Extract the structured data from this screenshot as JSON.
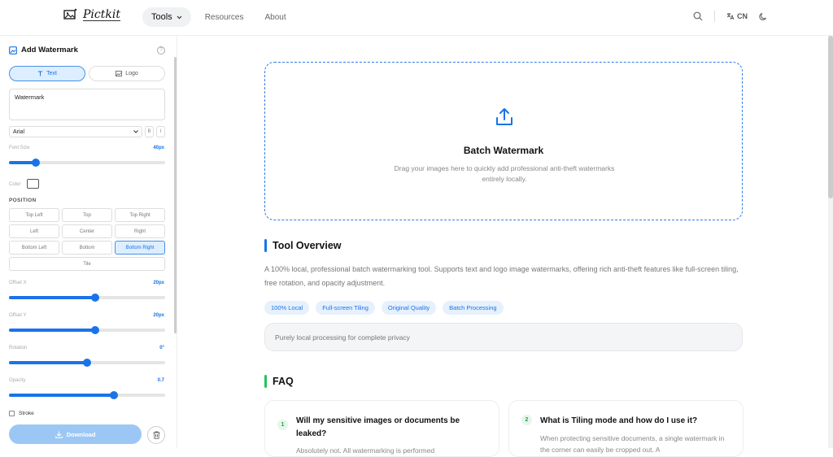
{
  "header": {
    "logo_text": "Pictkit",
    "nav": [
      {
        "label": "Tools"
      },
      {
        "label": "Resources"
      },
      {
        "label": "About"
      }
    ],
    "lang": "CN"
  },
  "sidebar": {
    "title": "Add Watermark",
    "help": "?",
    "tabs": [
      {
        "label": "Text"
      },
      {
        "label": "Logo"
      }
    ],
    "watermark_text": "Watermark",
    "font": "Arial",
    "bold": "B",
    "italic": "I",
    "font_size": {
      "label": "Font Size",
      "value": "40px",
      "level": 0.17
    },
    "color_label": "Color",
    "position_heading": "POSITION",
    "positions": [
      "Top Left",
      "Top",
      "Top Right",
      "Left",
      "Center",
      "Right",
      "Bottom Left",
      "Bottom",
      "Bottom Right",
      "Tile"
    ],
    "offset_x": {
      "label": "Offset X",
      "value": "20px",
      "level": 0.55
    },
    "offset_y": {
      "label": "Offset Y",
      "value": "20px",
      "level": 0.55
    },
    "rotation": {
      "label": "Rotation",
      "value": "0°",
      "level": 0.5
    },
    "opacity": {
      "label": "Opacity",
      "value": "0.7",
      "level": 0.67
    },
    "stroke_label": "Stroke",
    "download_label": "Download"
  },
  "main": {
    "drop_title": "Batch Watermark",
    "drop_sub": "Drag your images here to quickly add professional anti-theft watermarks entirely locally.",
    "overview_title": "Tool Overview",
    "overview_text": "A 100% local, professional batch watermarking tool. Supports text and logo image watermarks, offering rich anti-theft features like full-screen tiling, free rotation, and opacity adjustment.",
    "tags": [
      "100% Local",
      "Full-screen Tiling",
      "Original Quality",
      "Batch Processing"
    ],
    "note": "Purely local processing for complete privacy",
    "faq_title": "FAQ",
    "faq": [
      {
        "num": "1",
        "q": "Will my sensitive images or documents be leaked?",
        "a": "Absolutely not. All watermarking is performed"
      },
      {
        "num": "2",
        "q": "What is Tiling mode and how do I use it?",
        "a": "When protecting sensitive documents, a single watermark in the corner can easily be cropped out. A"
      }
    ]
  },
  "colors": {
    "accent": "#1a73e8",
    "overview_bar": "#1a73e8",
    "faq_bar": "#22c55e"
  }
}
